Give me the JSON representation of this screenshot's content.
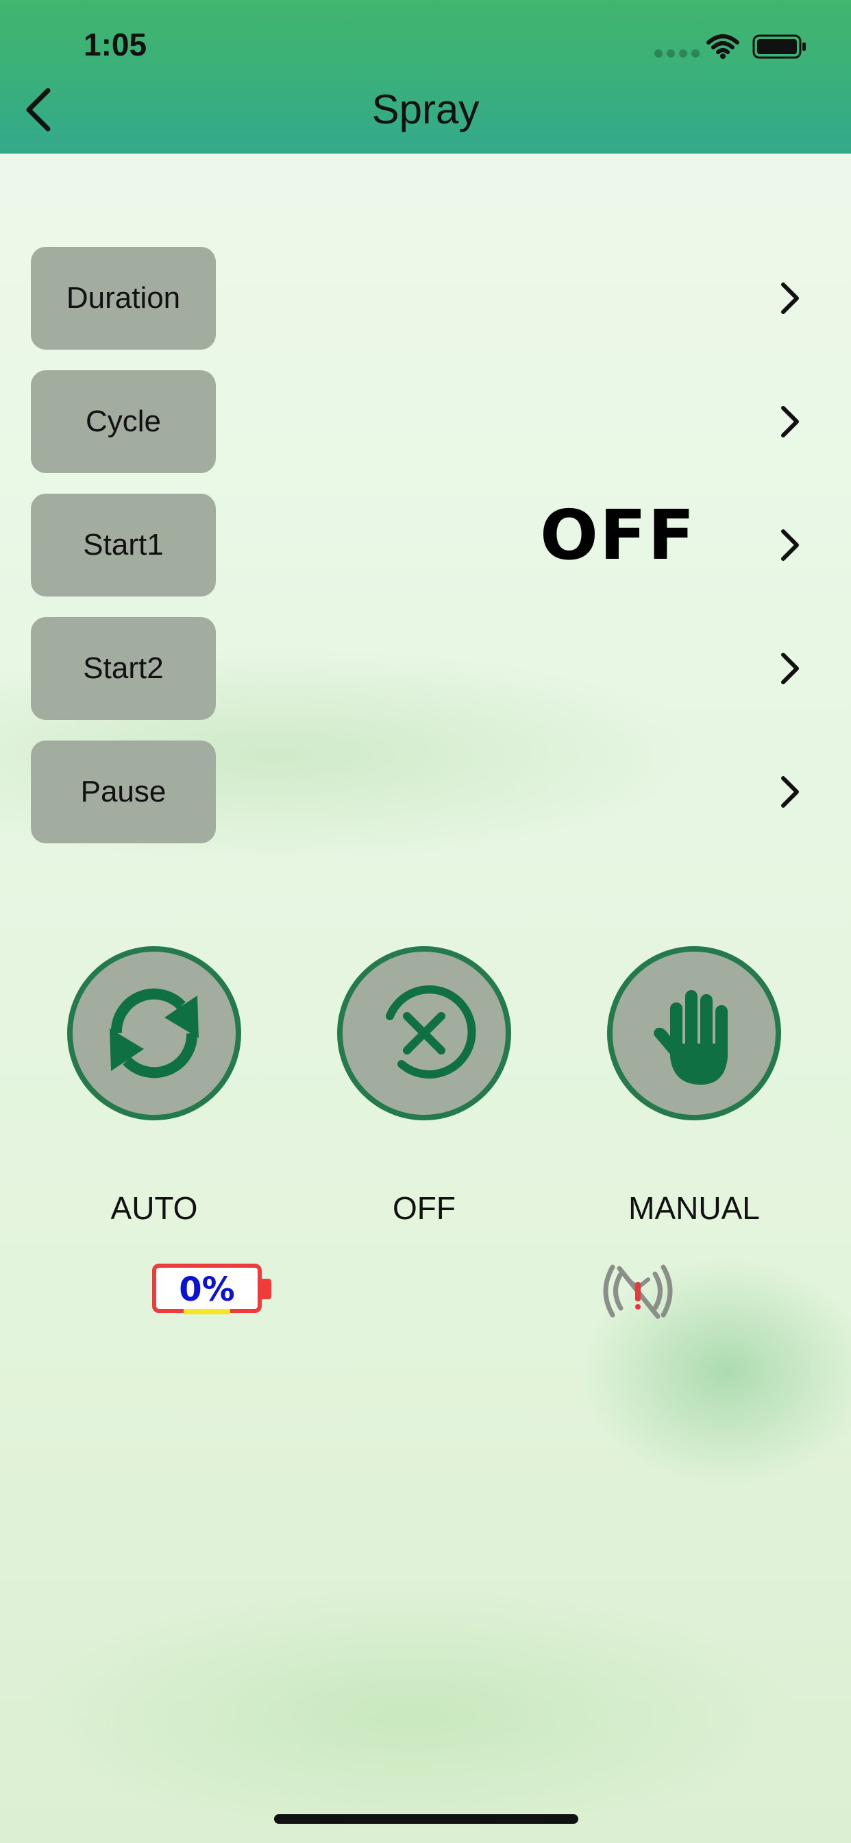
{
  "status_bar": {
    "time": "1:05"
  },
  "header": {
    "title": "Spray"
  },
  "settings": [
    {
      "label": "Duration"
    },
    {
      "label": "Cycle"
    },
    {
      "label": "Start1"
    },
    {
      "label": "Start2"
    },
    {
      "label": "Pause"
    }
  ],
  "status_value": "OFF",
  "modes": [
    {
      "label": "AUTO",
      "icon": "auto-sync-icon"
    },
    {
      "label": "OFF",
      "icon": "off-x-icon"
    },
    {
      "label": "MANUAL",
      "icon": "hand-icon"
    }
  ],
  "battery": {
    "text": "0%",
    "level": 0
  },
  "colors": {
    "header_top": "#41b66c",
    "header_bottom": "#33a98a",
    "button_fill": "#a3ad9f",
    "mode_ring": "#247a4c",
    "battery_border": "#ef3b3b",
    "battery_text": "#0a12d6"
  }
}
